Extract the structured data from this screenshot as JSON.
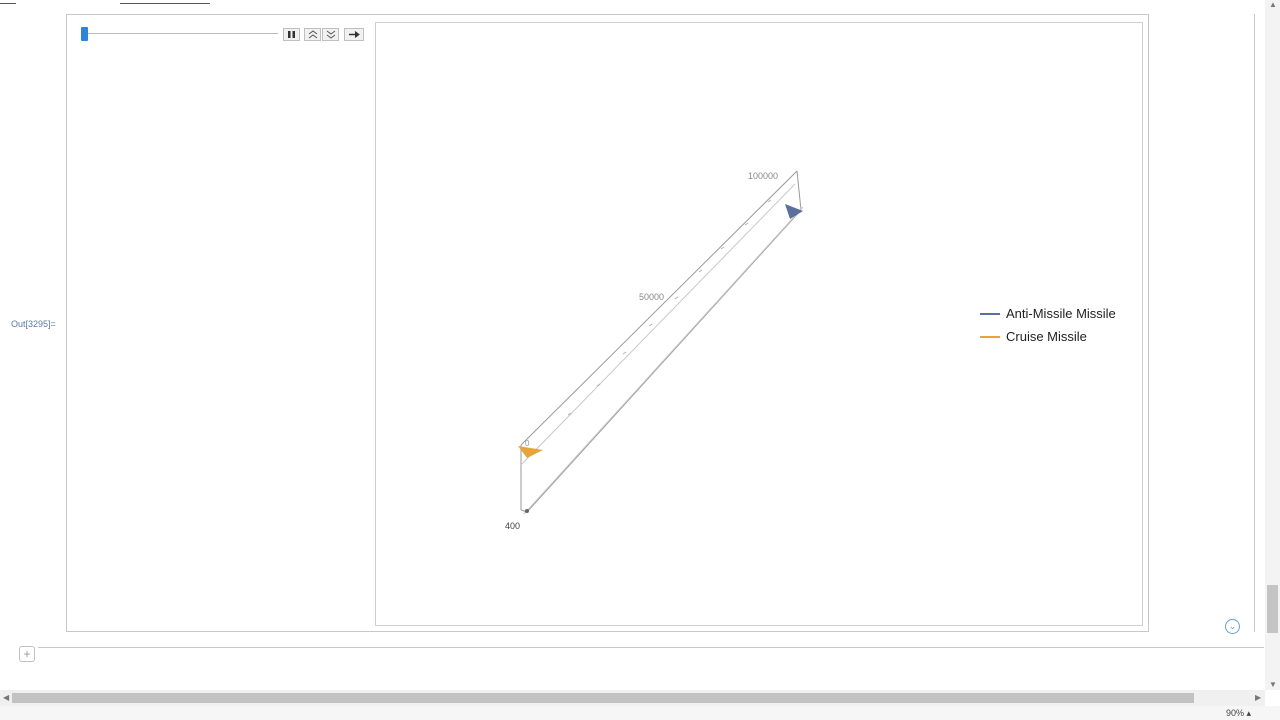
{
  "notebook": {
    "output_label": "Out[3295]=",
    "zoom": "90%",
    "insert_symbol": "+"
  },
  "manipulate": {
    "slider_value_fraction": 0.0,
    "controls": {
      "pause_label": "❚❚",
      "faster_label": "≈",
      "slower_label": "≈",
      "direction_label": "→"
    }
  },
  "plot": {
    "axis_labels": {
      "top_tick": "100000",
      "mid_tick": "50000",
      "bottom_tick": "0",
      "corner_label": "400"
    }
  },
  "legend": [
    {
      "label": "Anti-Missile Missile",
      "color": "#5b6f9f"
    },
    {
      "label": "Cruise Missile",
      "color": "#e5a53a"
    }
  ],
  "colors": {
    "accent": "#2b86d9",
    "anti_missile": "#5b6f9f",
    "cruise_missile": "#e5a53a"
  }
}
